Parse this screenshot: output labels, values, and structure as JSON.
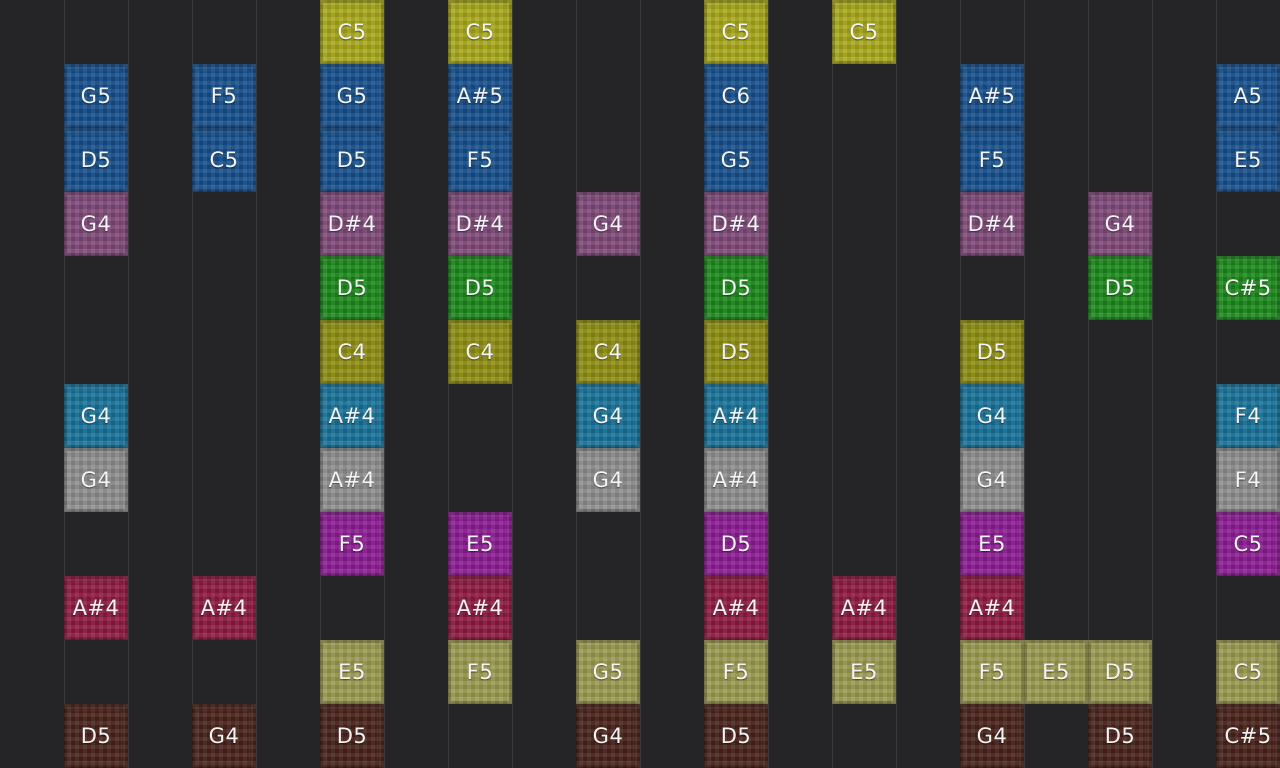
{
  "instruments": {
    "r0": {
      "color": "#a8a81a"
    },
    "r1": {
      "color": "#17508d"
    },
    "r2": {
      "color": "#17508d"
    },
    "r3": {
      "color": "#7f4a7a"
    },
    "r4": {
      "color": "#1c8a1c"
    },
    "r5": {
      "color": "#8f8f14"
    },
    "r6": {
      "color": "#19739a"
    },
    "r7": {
      "color": "#8e8e8e"
    },
    "r8": {
      "color": "#8d1c94"
    },
    "r9": {
      "color": "#8e1a40"
    },
    "r10": {
      "color": "#9a9a50"
    },
    "r11": {
      "color": "#4a241c"
    }
  },
  "notes": [
    {
      "row": 0,
      "col": 5,
      "label": "C5"
    },
    {
      "row": 0,
      "col": 7,
      "label": "C5"
    },
    {
      "row": 0,
      "col": 11,
      "label": "C5"
    },
    {
      "row": 0,
      "col": 13,
      "label": "C5"
    },
    {
      "row": 1,
      "col": 1,
      "label": "G5"
    },
    {
      "row": 1,
      "col": 3,
      "label": "F5"
    },
    {
      "row": 1,
      "col": 5,
      "label": "G5"
    },
    {
      "row": 1,
      "col": 7,
      "label": "A#5"
    },
    {
      "row": 1,
      "col": 11,
      "label": "C6"
    },
    {
      "row": 1,
      "col": 15,
      "label": "A#5"
    },
    {
      "row": 1,
      "col": 19,
      "label": "A5"
    },
    {
      "row": 2,
      "col": 1,
      "label": "D5"
    },
    {
      "row": 2,
      "col": 3,
      "label": "C5"
    },
    {
      "row": 2,
      "col": 5,
      "label": "D5"
    },
    {
      "row": 2,
      "col": 7,
      "label": "F5"
    },
    {
      "row": 2,
      "col": 11,
      "label": "G5"
    },
    {
      "row": 2,
      "col": 15,
      "label": "F5"
    },
    {
      "row": 2,
      "col": 19,
      "label": "E5"
    },
    {
      "row": 3,
      "col": 1,
      "label": "G4"
    },
    {
      "row": 3,
      "col": 5,
      "label": "D#4"
    },
    {
      "row": 3,
      "col": 7,
      "label": "D#4"
    },
    {
      "row": 3,
      "col": 9,
      "label": "G4"
    },
    {
      "row": 3,
      "col": 11,
      "label": "D#4"
    },
    {
      "row": 3,
      "col": 15,
      "label": "D#4"
    },
    {
      "row": 3,
      "col": 17,
      "label": "G4"
    },
    {
      "row": 4,
      "col": 5,
      "label": "D5"
    },
    {
      "row": 4,
      "col": 7,
      "label": "D5"
    },
    {
      "row": 4,
      "col": 11,
      "label": "D5"
    },
    {
      "row": 4,
      "col": 17,
      "label": "D5"
    },
    {
      "row": 4,
      "col": 19,
      "label": "C#5"
    },
    {
      "row": 5,
      "col": 5,
      "label": "C4"
    },
    {
      "row": 5,
      "col": 7,
      "label": "C4"
    },
    {
      "row": 5,
      "col": 9,
      "label": "C4"
    },
    {
      "row": 5,
      "col": 11,
      "label": "D5"
    },
    {
      "row": 5,
      "col": 15,
      "label": "D5"
    },
    {
      "row": 6,
      "col": 1,
      "label": "G4"
    },
    {
      "row": 6,
      "col": 5,
      "label": "A#4"
    },
    {
      "row": 6,
      "col": 9,
      "label": "G4"
    },
    {
      "row": 6,
      "col": 11,
      "label": "A#4"
    },
    {
      "row": 6,
      "col": 15,
      "label": "G4"
    },
    {
      "row": 6,
      "col": 19,
      "label": "F4"
    },
    {
      "row": 7,
      "col": 1,
      "label": "G4"
    },
    {
      "row": 7,
      "col": 5,
      "label": "A#4"
    },
    {
      "row": 7,
      "col": 9,
      "label": "G4"
    },
    {
      "row": 7,
      "col": 11,
      "label": "A#4"
    },
    {
      "row": 7,
      "col": 15,
      "label": "G4"
    },
    {
      "row": 7,
      "col": 19,
      "label": "F4"
    },
    {
      "row": 8,
      "col": 5,
      "label": "F5"
    },
    {
      "row": 8,
      "col": 7,
      "label": "E5"
    },
    {
      "row": 8,
      "col": 11,
      "label": "D5"
    },
    {
      "row": 8,
      "col": 15,
      "label": "E5"
    },
    {
      "row": 8,
      "col": 19,
      "label": "C5"
    },
    {
      "row": 9,
      "col": 1,
      "label": "A#4"
    },
    {
      "row": 9,
      "col": 3,
      "label": "A#4"
    },
    {
      "row": 9,
      "col": 7,
      "label": "A#4"
    },
    {
      "row": 9,
      "col": 11,
      "label": "A#4"
    },
    {
      "row": 9,
      "col": 13,
      "label": "A#4"
    },
    {
      "row": 9,
      "col": 15,
      "label": "A#4"
    },
    {
      "row": 10,
      "col": 5,
      "label": "E5"
    },
    {
      "row": 10,
      "col": 7,
      "label": "F5"
    },
    {
      "row": 10,
      "col": 9,
      "label": "G5"
    },
    {
      "row": 10,
      "col": 11,
      "label": "F5"
    },
    {
      "row": 10,
      "col": 13,
      "label": "E5"
    },
    {
      "row": 10,
      "col": 15,
      "label": "F5"
    },
    {
      "row": 10,
      "col": 16,
      "label": "E5"
    },
    {
      "row": 10,
      "col": 17,
      "label": "D5"
    },
    {
      "row": 10,
      "col": 19,
      "label": "C5"
    },
    {
      "row": 11,
      "col": 1,
      "label": "D5"
    },
    {
      "row": 11,
      "col": 3,
      "label": "G4"
    },
    {
      "row": 11,
      "col": 5,
      "label": "D5"
    },
    {
      "row": 11,
      "col": 9,
      "label": "G4"
    },
    {
      "row": 11,
      "col": 11,
      "label": "D5"
    },
    {
      "row": 11,
      "col": 15,
      "label": "G4"
    },
    {
      "row": 11,
      "col": 17,
      "label": "D5"
    },
    {
      "row": 11,
      "col": 19,
      "label": "C#5"
    }
  ]
}
